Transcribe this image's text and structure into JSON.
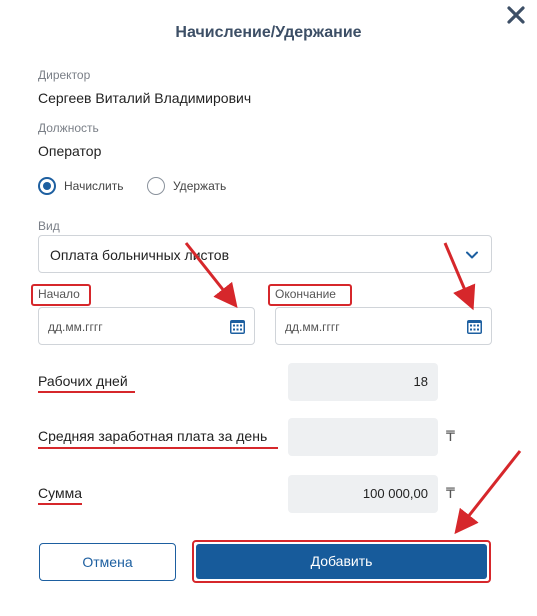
{
  "dialog": {
    "title": "Начисление/Удержание",
    "close_icon": "close-icon"
  },
  "director": {
    "label": "Директор",
    "value": "Сергеев Виталий Владимирович"
  },
  "position": {
    "label": "Должность",
    "value": "Оператор"
  },
  "operation": {
    "options": [
      {
        "label": "Начислить",
        "selected": true
      },
      {
        "label": "Удержать",
        "selected": false
      }
    ]
  },
  "type": {
    "label": "Вид",
    "selected": "Оплата больничных листов"
  },
  "start": {
    "label": "Начало",
    "placeholder": "дд.мм.гггг"
  },
  "end": {
    "label": "Окончание",
    "placeholder": "дд.мм.гггг"
  },
  "work_days": {
    "label": "Рабочих дней",
    "value": "18"
  },
  "avg_salary": {
    "label": "Средняя заработная плата за день",
    "value": "",
    "currency": "₸"
  },
  "sum": {
    "label": "Сумма",
    "value": "100 000,00",
    "currency": "₸"
  },
  "buttons": {
    "cancel": "Отмена",
    "add": "Добавить"
  },
  "colors": {
    "accent": "#175b9b",
    "highlight": "#d6272b"
  }
}
